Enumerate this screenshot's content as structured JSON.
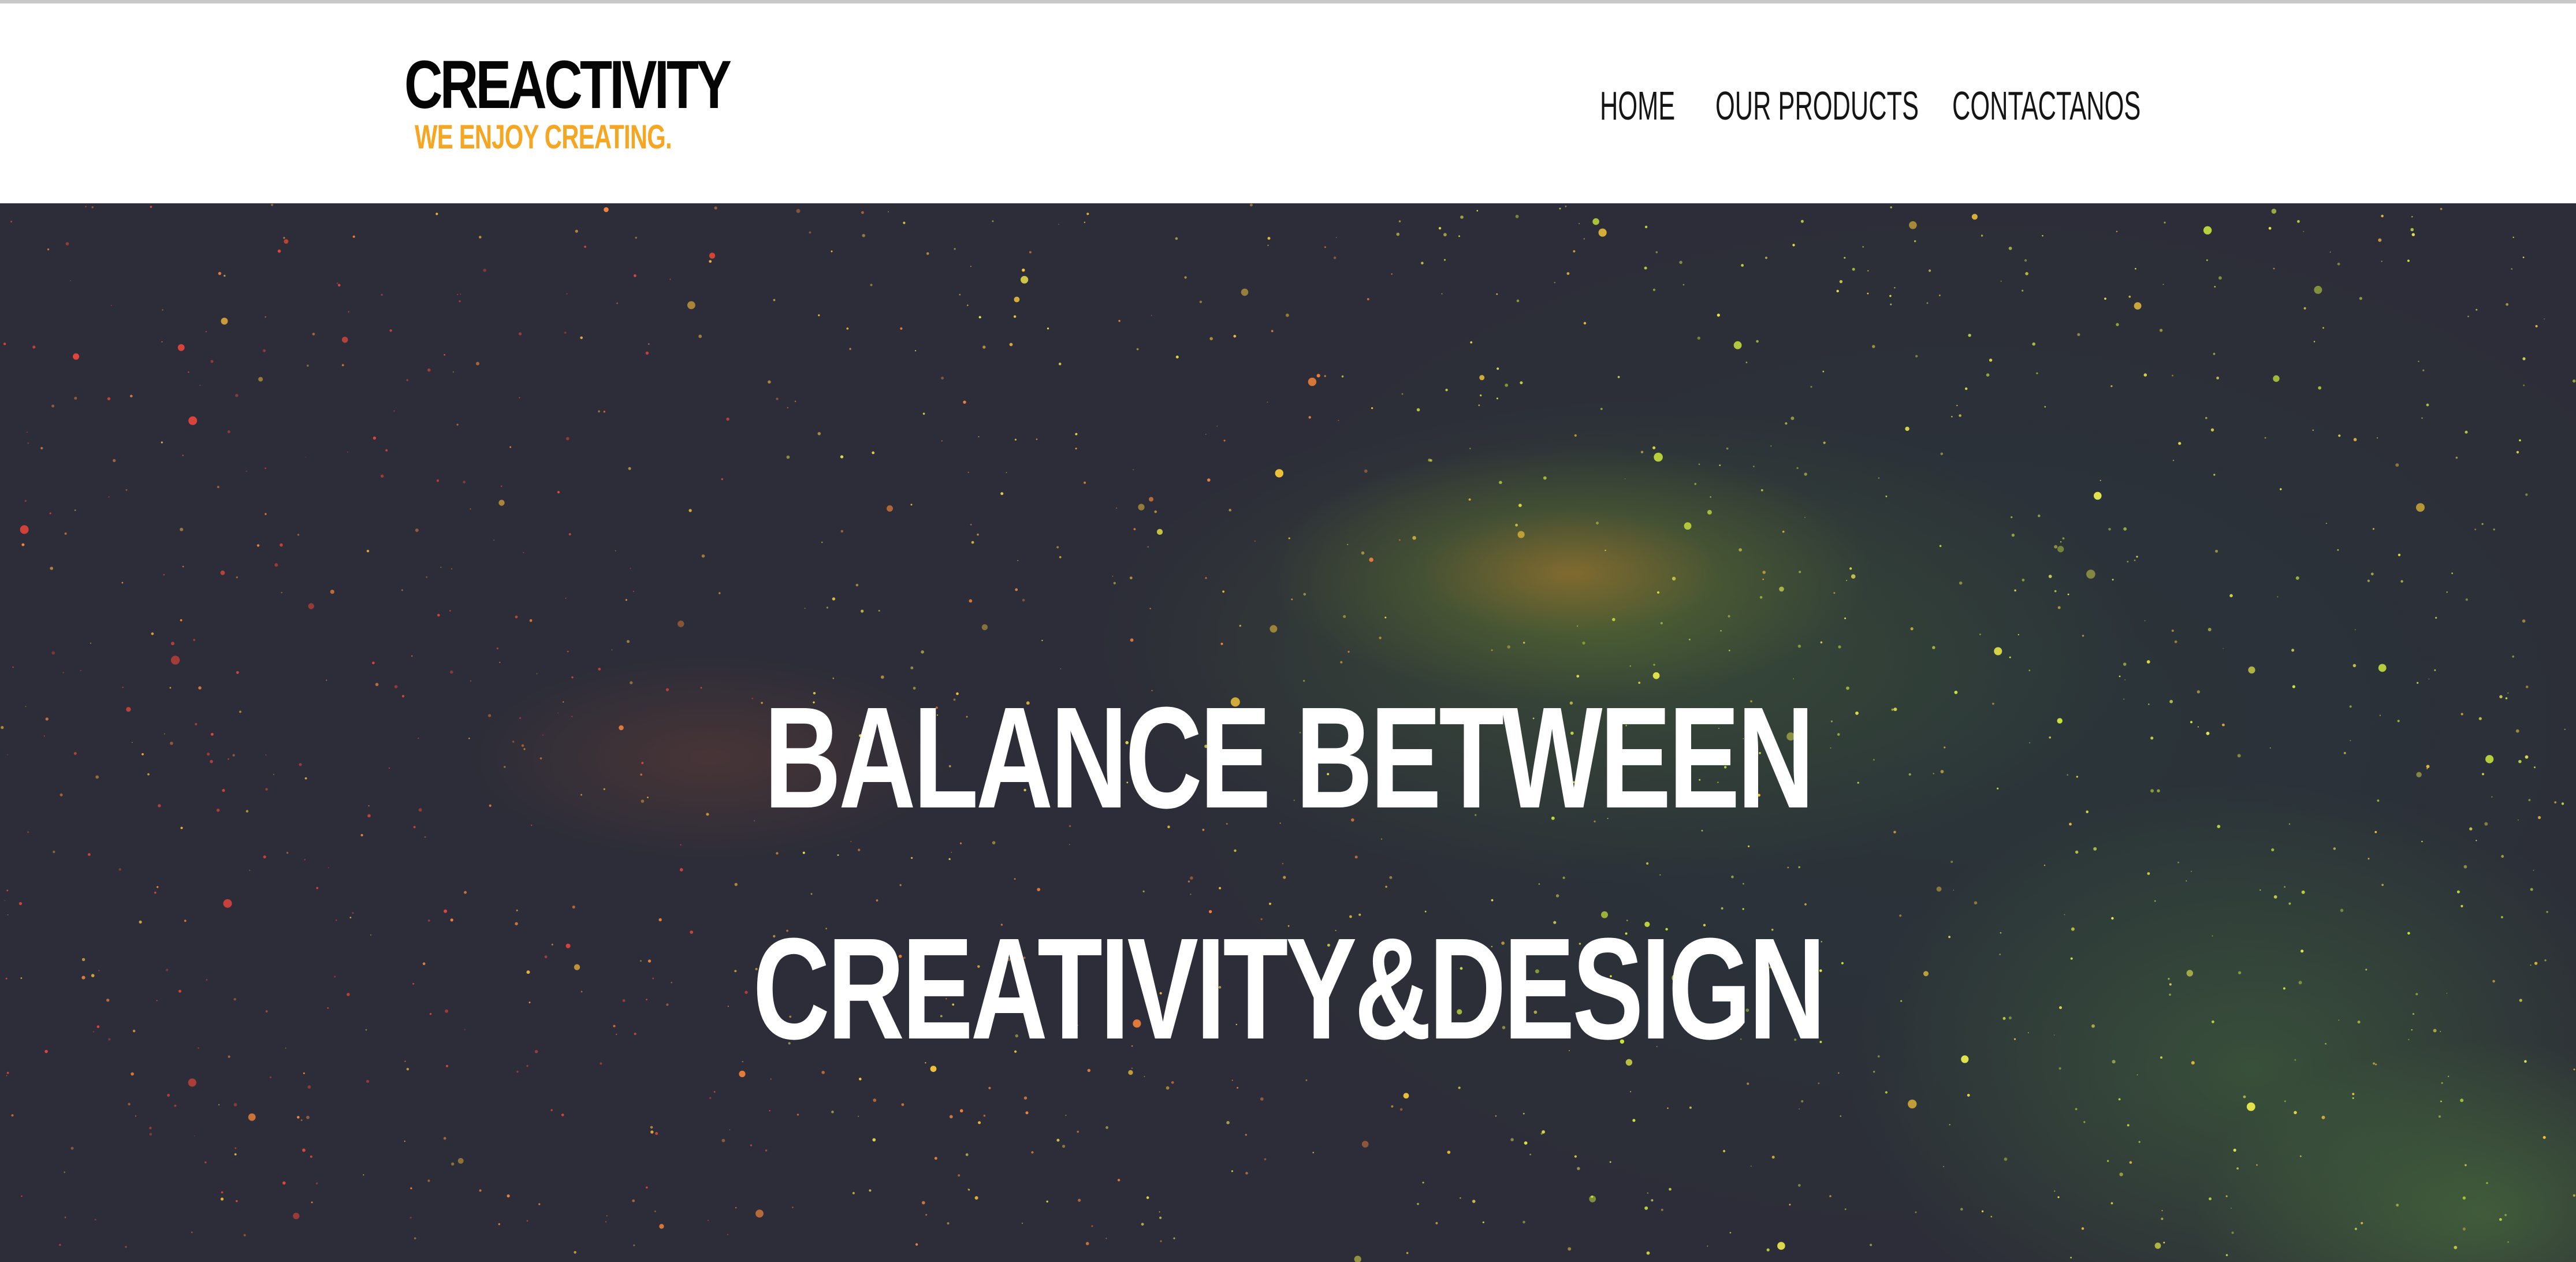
{
  "header": {
    "brand": {
      "name": "CREACTIVITY",
      "tagline": "WE ENJOY CREATING."
    },
    "nav": {
      "items": [
        {
          "label": "HOME"
        },
        {
          "label": "OUR PRODUCTS"
        },
        {
          "label": "CONTACTANOS"
        }
      ]
    }
  },
  "hero": {
    "headline_line1": "BALANCE BETWEEN",
    "headline_line2": "CREATIVITY&DESIGN",
    "background": "starry-night-sky-image"
  },
  "colors": {
    "brand_text": "#050505",
    "tagline": "#f5a623",
    "nav_text": "#151515",
    "hero_bg": "#2c2d38",
    "hero_text": "#ffffff"
  }
}
